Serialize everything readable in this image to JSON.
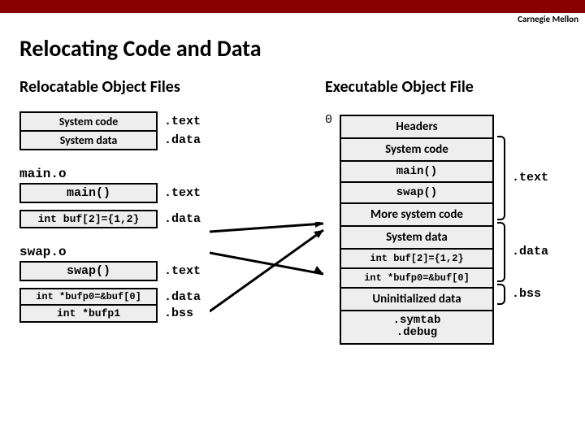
{
  "header": {
    "institution": "Carnegie Mellon",
    "title": "Relocating Code and Data"
  },
  "left": {
    "title": "Relocatable Object Files",
    "system": {
      "code": "System code",
      "data": "System data",
      "text": ".text",
      "secdata": ".data"
    },
    "main": {
      "obj": "main.o",
      "fn": "main()",
      "fn_sect": ".text",
      "buf": "int buf[2]={1,2}",
      "buf_sect": ".data"
    },
    "swap": {
      "obj": "swap.o",
      "fn": "swap()",
      "fn_sect": ".text",
      "bufp0": "int *bufp0=&buf[0]",
      "bufp0_sect": ".data",
      "bufp1": "int *bufp1",
      "bufp1_sect": ".bss"
    }
  },
  "right": {
    "title": "Executable Object File",
    "zero": "0",
    "cells": {
      "headers": "Headers",
      "syscode": "System code",
      "main": "main()",
      "swap": "swap()",
      "moresys": "More system code",
      "sysdata": "System data",
      "buf": "int buf[2]={1,2}",
      "bufp0": "int *bufp0=&buf[0]",
      "uninit": "Uninitialized data",
      "symdbg": ".symtab\n.debug"
    },
    "brackets": {
      "text": ".text",
      "data": ".data",
      "bss": ".bss"
    }
  }
}
